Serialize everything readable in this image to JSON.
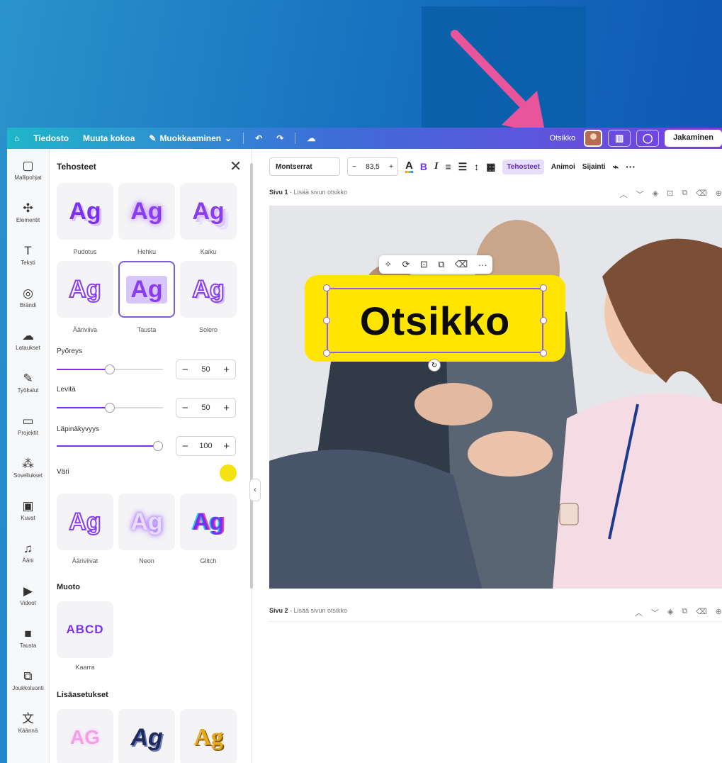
{
  "topbar": {
    "home_icon": "home-icon",
    "file": "Tiedosto",
    "resize": "Muuta kokoa",
    "editing": "Muokkaaminen",
    "doc_title": "Otsikko",
    "share": "Jakaminen"
  },
  "rail": {
    "items": [
      {
        "label": "Mallipohjat",
        "icon": "▢"
      },
      {
        "label": "Elementit",
        "icon": "✣"
      },
      {
        "label": "Teksti",
        "icon": "T"
      },
      {
        "label": "Brändi",
        "icon": "◎"
      },
      {
        "label": "Lataukset",
        "icon": "☁"
      },
      {
        "label": "Työkalut",
        "icon": "✎"
      },
      {
        "label": "Projektit",
        "icon": "▭"
      },
      {
        "label": "Sovellukset",
        "icon": "⁂"
      },
      {
        "label": "Kuvat",
        "icon": "▣"
      },
      {
        "label": "Ääni",
        "icon": "♫"
      },
      {
        "label": "Videot",
        "icon": "▶"
      },
      {
        "label": "Tausta",
        "icon": "■"
      },
      {
        "label": "Joukkoluonti",
        "icon": "⧉"
      },
      {
        "label": "Käännä",
        "icon": "文"
      }
    ]
  },
  "panel": {
    "title": "Tehosteet",
    "styles": [
      {
        "label": "Pudotus",
        "text": "Ag"
      },
      {
        "label": "Hehku",
        "text": "Ag"
      },
      {
        "label": "Kaiku",
        "text": "Ag"
      },
      {
        "label": "Ääriviiva",
        "text": "Ag"
      },
      {
        "label": "Tausta",
        "text": "Ag"
      },
      {
        "label": "Solero",
        "text": "Ag"
      },
      {
        "label": "Ääriviivat",
        "text": "Ag"
      },
      {
        "label": "Neon",
        "text": "Ag"
      },
      {
        "label": "Glitch",
        "text": "Ag"
      }
    ],
    "selected_style": "Tausta",
    "roundness": {
      "label": "Pyöreys",
      "value": "50",
      "fraction": 0.5
    },
    "spread": {
      "label": "Levitä",
      "value": "50",
      "fraction": 0.5
    },
    "opacity": {
      "label": "Läpinäkyvyys",
      "value": "100",
      "fraction": 1.0
    },
    "color_label": "Väri",
    "color": "#f3e311",
    "shape_title": "Muoto",
    "shape_item": {
      "label": "Kaarra",
      "text": "ABCD"
    },
    "advanced_title": "Lisäasetukset",
    "advanced": [
      {
        "text": "AG"
      },
      {
        "text": "Ag"
      },
      {
        "text": "Ag"
      }
    ]
  },
  "format_bar": {
    "font": "Montserrat",
    "size": "83,5",
    "effects": "Tehosteet",
    "animate": "Animoi",
    "position": "Sijainti"
  },
  "page1": {
    "label": "Sivu 1",
    "placeholder": "- Lisää sivun otsikko"
  },
  "page2": {
    "label": "Sivu 2",
    "placeholder": "- Lisää sivun otsikko"
  },
  "canvas": {
    "heading": "Otsikko",
    "highlight_color": "#ffe500"
  },
  "colors": {
    "accent": "#7b2ff2",
    "arrow": "#e8559a"
  }
}
